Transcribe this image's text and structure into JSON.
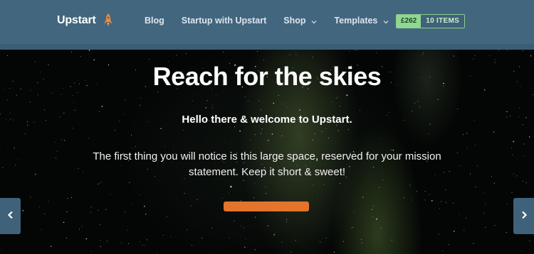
{
  "header": {
    "logo_text": "Upstart",
    "nav": [
      {
        "label": "Blog",
        "dropdown": false
      },
      {
        "label": "Startup with Upstart",
        "dropdown": false
      },
      {
        "label": "Shop",
        "dropdown": true
      },
      {
        "label": "Templates",
        "dropdown": true
      }
    ],
    "cart": {
      "price": "£262",
      "items": "10 ITEMS"
    }
  },
  "hero": {
    "title": "Reach for the skies",
    "subtitle": "Hello there & welcome to Upstart.",
    "body": "The first thing you will notice is this large space, reserved for your mission statement. Keep it short & sweet!"
  },
  "colors": {
    "header_bg": "#43667f",
    "accent_orange": "#e3742b",
    "cart_green": "#91d691"
  },
  "icons": {
    "logo": "rocket-icon",
    "dropdown": "chevron-down-icon",
    "prev": "chevron-left-icon",
    "next": "chevron-right-icon"
  }
}
